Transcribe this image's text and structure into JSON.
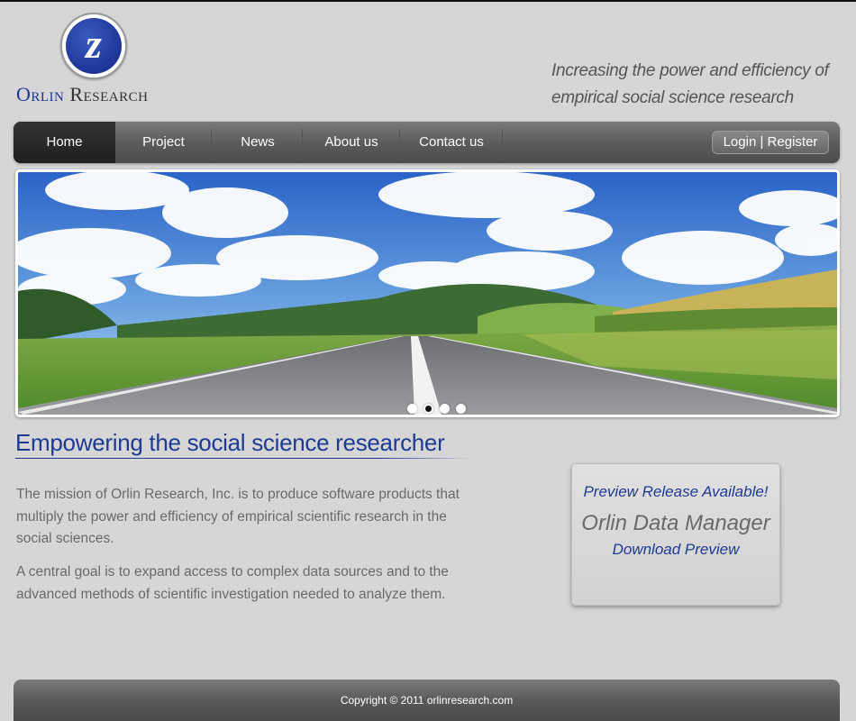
{
  "logo": {
    "glyph": "z",
    "text_first": "Orlin",
    "text_second": "Research",
    "colors": {
      "primary": "#1d3597",
      "secondary": "#333333"
    }
  },
  "tagline": "Increasing the power and efficiency of empirical social science research",
  "nav": {
    "items": [
      {
        "label": "Home",
        "active": true
      },
      {
        "label": "Project",
        "active": false
      },
      {
        "label": "News",
        "active": false
      },
      {
        "label": "About us",
        "active": false
      },
      {
        "label": "Contact us",
        "active": false
      }
    ],
    "login_label": "Login",
    "separator": "|",
    "register_label": "Register"
  },
  "slider": {
    "slide_count": 4,
    "active_index": 1,
    "image": "road-landscape"
  },
  "main": {
    "headline": "Empowering the social science researcher",
    "paragraph_1": "The mission of Orlin Research, Inc. is to produce software products that multiply the power and efficiency of empirical scientific research in the social sciences.",
    "paragraph_2": "A central goal is to expand access to complex data sources and to the advanced methods of scientific investigation needed to analyze them."
  },
  "preview_box": {
    "title": "Preview Release Available!",
    "product": "Orlin Data Manager",
    "link": "Download Preview"
  },
  "footer": {
    "copyright": "Copyright © 2011 orlinresearch.com"
  },
  "colors": {
    "accent_blue": "#1f3a93",
    "page_bg": "#d6d6d6",
    "nav_bg": "#5c5c5c"
  }
}
